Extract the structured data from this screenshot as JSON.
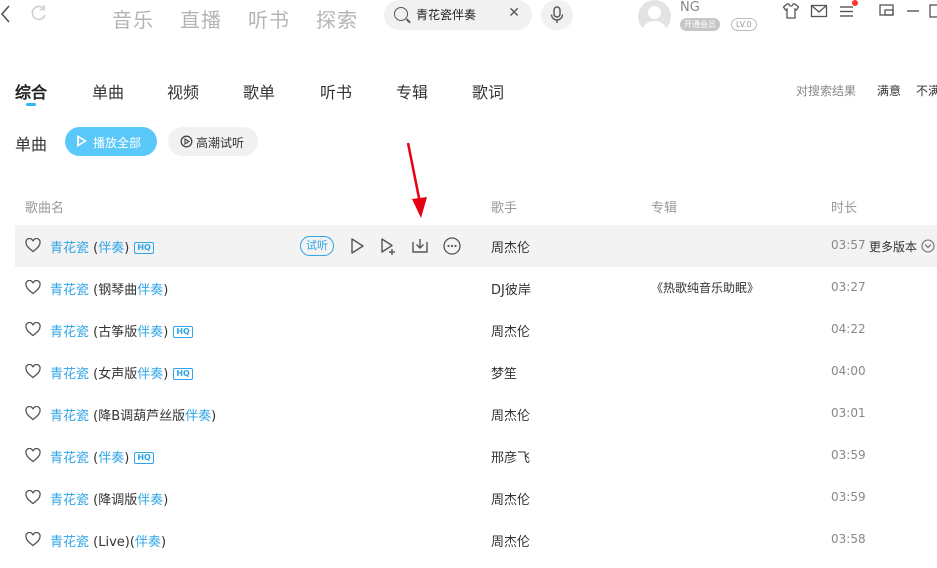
{
  "topbar": {
    "back_icon": "chevron-left-icon",
    "refresh_icon": "refresh-icon",
    "nav": [
      "音乐",
      "直播",
      "听书",
      "探索"
    ],
    "search": {
      "value": "青花瓷伴奏",
      "icon": "search-icon"
    },
    "user": {
      "name": "NG",
      "vip_label": "开通会员",
      "level": "LV.0"
    }
  },
  "tabs": [
    "综合",
    "单曲",
    "视频",
    "歌单",
    "听书",
    "专辑",
    "歌词"
  ],
  "feedback": {
    "prompt": "对搜索结果",
    "satisfied": "满意",
    "unsatisfied": "不满"
  },
  "section": {
    "title": "单曲",
    "play_all": "播放全部",
    "highlight": "高潮试听"
  },
  "table": {
    "headers": {
      "song": "歌曲名",
      "artist": "歌手",
      "album": "专辑",
      "duration": "时长"
    },
    "trial_label": "试听",
    "more_versions": "更多版本",
    "hq_label": "HQ",
    "rows": [
      {
        "name": "青花瓷",
        "suffix_pre": " (",
        "suffix_hl": "伴奏",
        "suffix_mid": "",
        "suffix_post": ")",
        "hq": true,
        "artist": "周杰伦",
        "album": "",
        "duration": "03:57"
      },
      {
        "name": "青花瓷",
        "suffix_pre": " (钢琴曲",
        "suffix_hl": "伴奏",
        "suffix_mid": "",
        "suffix_post": ")",
        "hq": false,
        "artist": "DJ彼岸",
        "album": "《热歌纯音乐助眠》",
        "duration": "03:27"
      },
      {
        "name": "青花瓷",
        "suffix_pre": " (古筝版",
        "suffix_hl": "伴奏",
        "suffix_mid": "",
        "suffix_post": ")",
        "hq": true,
        "artist": "周杰伦",
        "album": "",
        "duration": "04:22"
      },
      {
        "name": "青花瓷",
        "suffix_pre": " (女声版",
        "suffix_hl": "伴奏",
        "suffix_mid": "",
        "suffix_post": ")",
        "hq": true,
        "artist": "梦笙",
        "album": "",
        "duration": "04:00"
      },
      {
        "name": "青花瓷",
        "suffix_pre": " (降B调葫芦丝版",
        "suffix_hl": "伴奏",
        "suffix_mid": "",
        "suffix_post": ")",
        "hq": false,
        "artist": "周杰伦",
        "album": "",
        "duration": "03:01"
      },
      {
        "name": "青花瓷",
        "suffix_pre": " (",
        "suffix_hl": "伴奏",
        "suffix_mid": "",
        "suffix_post": ")",
        "hq": true,
        "artist": "邢彦飞",
        "album": "",
        "duration": "03:59"
      },
      {
        "name": "青花瓷",
        "suffix_pre": " (降调版",
        "suffix_hl": "伴奏",
        "suffix_mid": "",
        "suffix_post": ")",
        "hq": false,
        "artist": "周杰伦",
        "album": "",
        "duration": "03:59"
      },
      {
        "name": "青花瓷",
        "suffix_pre": " (Live)(",
        "suffix_hl": "伴奏",
        "suffix_mid": "",
        "suffix_post": ")",
        "hq": false,
        "artist": "周杰伦",
        "album": "",
        "duration": "03:58"
      }
    ]
  },
  "colors": {
    "accent": "#2fa4e7",
    "play_all_bg": "#5bc8fa",
    "annotation_arrow": "#e60012"
  }
}
